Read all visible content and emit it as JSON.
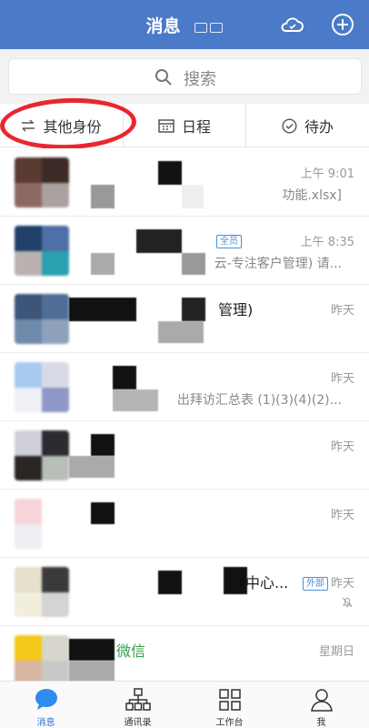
{
  "header": {
    "title": "消息"
  },
  "search": {
    "placeholder": "搜索"
  },
  "quick_actions": [
    {
      "label": "其他身份",
      "icon": "switch-icon"
    },
    {
      "label": "日程",
      "icon": "calendar-icon"
    },
    {
      "label": "待办",
      "icon": "check-circle-icon"
    }
  ],
  "conversations": [
    {
      "name": "",
      "preview": "功能.xlsx]",
      "time": "上午 9:01"
    },
    {
      "name": "",
      "badge": "全员",
      "preview": "云-专注客户管理) 请...",
      "time": "上午 8:35"
    },
    {
      "name": "管理)",
      "preview": "",
      "time": "昨天"
    },
    {
      "name": "",
      "preview": "出拜访汇总表 (1)(3)(4)(2)...",
      "time": "昨天"
    },
    {
      "name": "",
      "preview": "",
      "time": "昨天"
    },
    {
      "name": "",
      "preview": "",
      "time": "昨天"
    },
    {
      "name": "中心...",
      "badge": "外部",
      "preview": "",
      "time": "昨天",
      "muted": true
    },
    {
      "name": "微信",
      "preview": "",
      "time": "星期日"
    }
  ],
  "tabbar": [
    {
      "label": "消息",
      "active": true
    },
    {
      "label": "通讯录"
    },
    {
      "label": "工作台"
    },
    {
      "label": "我"
    }
  ],
  "colors": {
    "header": "#4a7ac8",
    "accent": "#2e6fd0",
    "annotation_circle": "#e8272f",
    "green_name": "#2fa04a"
  }
}
